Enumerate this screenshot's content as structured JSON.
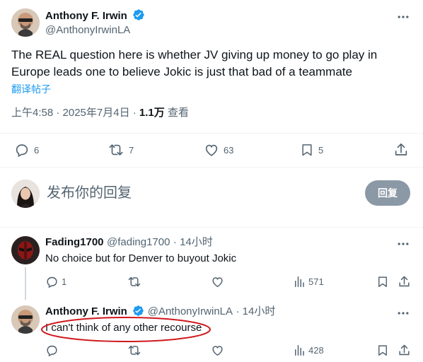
{
  "main_tweet": {
    "author_name": "Anthony F. Irwin",
    "author_handle": "@AnthonyIrwinLA",
    "text": "The REAL question here is whether JV giving up money to go play in Europe leads one to believe Jokic is just that bad of a teammate",
    "translate_link": "翻译帖子",
    "time": "上午4:58 · 2025年7月4日 ·",
    "views_count": "1.1万",
    "views_label": "查看",
    "replies": "6",
    "retweets": "7",
    "likes": "63",
    "bookmarks": "5"
  },
  "composer": {
    "placeholder": "发布你的回复",
    "reply_button": "回复"
  },
  "replies": [
    {
      "author_name": "Fading1700",
      "author_handle": "@fading1700",
      "time": "· 14小时",
      "text": "No choice but for Denver to buyout Jokic",
      "reply_count": "1",
      "views": "571"
    },
    {
      "author_name": "Anthony F. Irwin",
      "author_handle": "@AnthonyIrwinLA",
      "time": "· 14小时",
      "text": "I can't think of any other recourse",
      "views": "428"
    }
  ],
  "colors": {
    "accent": "#1d9bf0",
    "muted": "#536471",
    "annotation": "#d0181e",
    "reply_button_bg": "#8b98a5"
  },
  "icons": [
    "more-icon",
    "verified-badge-icon",
    "reply-icon",
    "retweet-icon",
    "like-icon",
    "bookmark-icon",
    "share-icon",
    "views-icon"
  ]
}
